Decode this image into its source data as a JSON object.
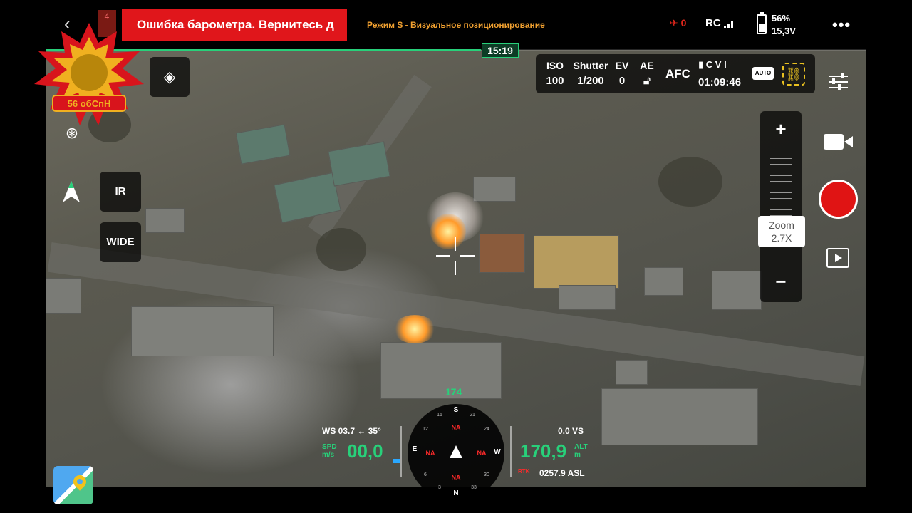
{
  "top_bar": {
    "back_icon": "chevron-left-icon",
    "notification_count": "4",
    "error_banner": "Ошибка барометра. Вернитесь д",
    "mode_text": "Режим S - Визуальное позиционирование",
    "flight_status_value": "0",
    "rc_label": "RC",
    "battery_percent": "56%",
    "battery_voltage": "15,3V",
    "battery_level": 0.56,
    "more_label": "•••"
  },
  "flight_time": "15:19",
  "flight_progress": 0.53,
  "camera": {
    "iso_label": "ISO",
    "iso_value": "100",
    "shutter_label": "Shutter",
    "shutter_value": "1/200",
    "ev_label": "EV",
    "ev_value": "0",
    "ae_label": "AE",
    "ae_lock_icon": "lock-icon",
    "focus_mode": "AFC",
    "storage_label": "C V I",
    "record_time": "01:09:46",
    "auto_label": "AUTO"
  },
  "unit_emblem_text": "56 обСпН",
  "left_controls": {
    "ir_label": "IR",
    "wide_label": "WIDE"
  },
  "zoom": {
    "plus": "+",
    "minus": "−",
    "label": "Zoom",
    "value": "2.7X"
  },
  "telemetry": {
    "ws_text": "WS 03.7 ← 35°",
    "spd_label": "SPD",
    "spd_unit": "m/s",
    "speed": "00,0",
    "heading": "174",
    "vs_text": "0.0  VS",
    "alt_label": "ALT",
    "alt_unit": "m",
    "altitude": "170,9",
    "asl_label": "RTK",
    "asl_value": "0257.9 ASL"
  },
  "compass": {
    "north": "N",
    "south": "S",
    "east": "E",
    "west": "W",
    "na": "NA",
    "ticks": [
      "12",
      "15",
      "21",
      "24",
      "30",
      "33",
      "3",
      "6"
    ]
  },
  "colors": {
    "accent_green": "#28d07a",
    "error_red": "#e0161b",
    "mode_orange": "#f0a030",
    "record_red": "#e01414"
  }
}
